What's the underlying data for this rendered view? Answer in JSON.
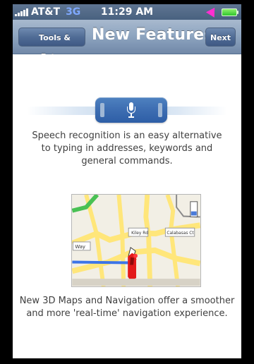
{
  "status_bar": {
    "carrier": "AT&T",
    "network": "3G",
    "time": "11:29 AM"
  },
  "navigation": {
    "back_label": "Tools & Extras",
    "title": "New Features",
    "next_label": "Next"
  },
  "content": {
    "speech_text": "Speech recognition  is an easy alternative to typing  in addresses, keywords and general commands.",
    "maps_text": "New 3D Maps and Navigation offer a smoother and more 'real-time' navigation experience.",
    "map_labels": [
      "Way",
      "Kiley Rd",
      "Calabasas Ct"
    ]
  },
  "colors": {
    "status_bar": "#48617f",
    "nav_bar": "#8fa6c1",
    "button": "#4f6b95",
    "speech_pill": "#3f6fb3",
    "map_route": "#3c74e8",
    "text": "#3f3f3f"
  },
  "icons": {
    "signal": "signal-icon",
    "location": "location-icon",
    "battery": "battery-icon",
    "microphone": "microphone-icon",
    "map": "map-icon"
  }
}
